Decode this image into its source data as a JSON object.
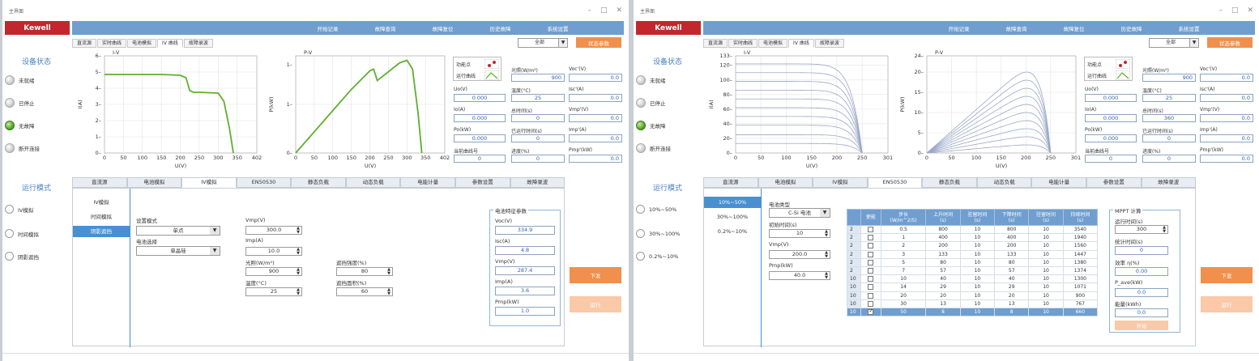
{
  "title": "主界面",
  "brand": "Kewell",
  "topnav": [
    "开始记录",
    "故障查询",
    "故障复位",
    "历史故障",
    "系统设置"
  ],
  "side": {
    "status_title": "设备状态",
    "statuses": [
      "未就绪",
      "已停止",
      "无故障",
      "断开连接"
    ],
    "mode_title": "运行模式"
  },
  "tabs_top": [
    "直流源",
    "实时曲线",
    "电池模拟",
    "IV 曲线",
    "故障录波"
  ],
  "select_all": "全部",
  "status_btn": "状态参数",
  "labels": {
    "func": "功能点",
    "run_curve": "运行曲线",
    "uo": "Uo(V)",
    "io": "Io(A)",
    "po": "Po(kW)",
    "curve_no": "当前曲线号",
    "irr": "光照(W/m²)",
    "temp": "温度(°C)",
    "tot": "总时间(s)",
    "elapsed": "已运行时间(s)",
    "progress": "进度(%)",
    "voc": "Voc'(V)",
    "isc": "Isc'(A)",
    "vmp": "Vmp'(V)",
    "imp": "Imp'(A)",
    "pmp": "Pmp'(kW)"
  },
  "w1": {
    "vals": {
      "irr": "900",
      "temp": "25",
      "tot": "0",
      "elapsed": "0",
      "progress": "0",
      "uo": "0.000",
      "io": "0.000",
      "po": "0.000",
      "curve_no": "0",
      "voc": "0.0",
      "isc": "0.0",
      "vmp": "0.0",
      "imp": "0.0",
      "pmp": "0.0"
    },
    "modes": [
      "IV模拟",
      "时间模拟",
      "阴影遮挡"
    ],
    "subtabs": [
      "IV模拟",
      "时间模拟",
      "阴影遮挡"
    ],
    "form": {
      "setmode_label": "设置模式",
      "setmode_value": "单点",
      "battery_label": "电池选择",
      "battery_value": "单晶硅",
      "vmp_label": "Vmp(V)",
      "vmp_value": "300.0",
      "imp_label": "Imp(A)",
      "imp_value": "10.0",
      "irr_label": "光照(W/m²)",
      "irr_value": "900",
      "temp_label": "温度(°C)",
      "temp_value": "25",
      "shade_label": "遮挡强度(%)",
      "shade_value": "80",
      "area_label": "遮挡面积(%)",
      "area_value": "60"
    },
    "char_title": "电池特征参数",
    "char": [
      {
        "label": "Voc(V)",
        "value": "334.9"
      },
      {
        "label": "Isc(A)",
        "value": "4.8"
      },
      {
        "label": "Vmp(V)",
        "value": "287.4"
      },
      {
        "label": "Imp(A)",
        "value": "3.6"
      },
      {
        "label": "Pmp(kW)",
        "value": "1.0"
      }
    ]
  },
  "w2": {
    "vals": {
      "irr": "900",
      "temp": "25",
      "tot": "360",
      "elapsed": "0",
      "progress": "0",
      "uo": "0.000",
      "io": "0.000",
      "po": "0.000",
      "curve_no": "0",
      "voc": "0.0",
      "isc": "0.0",
      "vmp": "0.0",
      "imp": "0.0",
      "pmp": "0.0"
    },
    "modes": [
      "10%~50%",
      "30%~100%",
      "0.2%~10%"
    ],
    "subtabs": [
      "10%~50%",
      "30%~100%",
      "0.2%~10%"
    ],
    "form": {
      "type_label": "电池类型",
      "type_value": "C-Si 电池",
      "init_label": "初始时间(s)",
      "init_value": "10",
      "vmp_label": "Vmp(V)",
      "vmp_value": "200.0",
      "pmp_label": "Pmp(kW)",
      "pmp_value": "40.0"
    },
    "table": {
      "headers": [
        "",
        "使能",
        "步长\n(W/m^2/S)",
        "上升时间\n(s)",
        "驻留时间\n(s)",
        "下降时间\n(s)",
        "驻留时间\n(s)",
        "持续时间\n(s)"
      ],
      "rows": [
        [
          "2",
          "0.5",
          "800",
          "10",
          "800",
          "10",
          "3540"
        ],
        [
          "2",
          "1",
          "400",
          "10",
          "400",
          "10",
          "1940"
        ],
        [
          "2",
          "2",
          "200",
          "10",
          "200",
          "10",
          "1560"
        ],
        [
          "2",
          "3",
          "133",
          "10",
          "133",
          "10",
          "1447"
        ],
        [
          "2",
          "5",
          "80",
          "10",
          "80",
          "10",
          "1380"
        ],
        [
          "2",
          "7",
          "57",
          "10",
          "57",
          "10",
          "1374"
        ],
        [
          "10",
          "10",
          "40",
          "10",
          "40",
          "10",
          "1300"
        ],
        [
          "10",
          "14",
          "29",
          "10",
          "29",
          "10",
          "1071"
        ],
        [
          "10",
          "20",
          "20",
          "10",
          "20",
          "10",
          "900"
        ],
        [
          "10",
          "30",
          "13",
          "10",
          "13",
          "10",
          "767"
        ],
        [
          "10",
          "50",
          "8",
          "10",
          "8",
          "10",
          "660"
        ]
      ]
    },
    "mppt": {
      "title": "MPPT 计算",
      "runtime_label": "运行时间(s)",
      "runtime_value": "300",
      "stat_label": "统计时间(s)",
      "stat_value": "0",
      "eff_label": "效率 η(%)",
      "eff_value": "0.00",
      "pave_label": "P_ave(kW)",
      "pave_value": "0.0",
      "energy_label": "能量(kWh)",
      "energy_value": "0.0",
      "start": "开始"
    }
  },
  "tabs_bottom": [
    "直流源",
    "电池模拟",
    "IV模拟",
    "EN50530",
    "静态负载",
    "动态负载",
    "电能计量",
    "参数设置",
    "故障录波"
  ],
  "btn_send": "下发",
  "btn_run": "运行",
  "chart_data": [
    {
      "type": "line",
      "title": "",
      "ylabel": "I(A)",
      "xlabel": "U(V)",
      "xlim": [
        0,
        402
      ],
      "ylim": [
        0,
        6
      ],
      "xticks": [
        "0",
        "50",
        "100",
        "150",
        "200",
        "250",
        "300",
        "350",
        "402"
      ],
      "yticks": [
        "0",
        "1",
        "2",
        "3",
        "4",
        "5",
        "6"
      ],
      "corner": "I-V",
      "series": [
        {
          "x": [
            0,
            150,
            200,
            215,
            225,
            235,
            250,
            300,
            315,
            330,
            340
          ],
          "y": [
            4.85,
            4.85,
            4.8,
            4.65,
            3.85,
            3.75,
            3.75,
            3.7,
            3.2,
            1.5,
            0
          ]
        }
      ]
    },
    {
      "type": "line",
      "title": "",
      "ylabel": "P(kW)",
      "xlabel": "U(V)",
      "xlim": [
        0,
        402
      ],
      "ylim": [
        0,
        1.1
      ],
      "xticks": [
        "0",
        "50",
        "100",
        "150",
        "200",
        "250",
        "300",
        "350",
        "402"
      ],
      "yticks": [
        "0",
        "1"
      ],
      "yticklevels": [
        0,
        0.55,
        1.0
      ],
      "corner": "P-V",
      "series": [
        {
          "x": [
            0,
            50,
            100,
            150,
            200,
            210,
            220,
            235,
            250,
            280,
            300,
            315,
            330,
            340
          ],
          "y": [
            0,
            0.24,
            0.48,
            0.72,
            0.93,
            0.95,
            0.82,
            0.87,
            0.92,
            1.02,
            1.05,
            0.95,
            0.45,
            0
          ]
        }
      ]
    },
    {
      "type": "line",
      "title": "",
      "ylabel": "I(A)",
      "xlabel": "U(V)",
      "xlim": [
        0,
        301
      ],
      "ylim": [
        0,
        133
      ],
      "xticks": [
        "0",
        "50",
        "100",
        "150",
        "200",
        "250",
        "301"
      ],
      "yticks": [
        "0",
        "20",
        "40",
        "60",
        "80",
        "100",
        "120",
        "133"
      ],
      "corner": "I-V",
      "series": [
        {
          "isc": [
            13,
            25,
            38,
            50,
            62,
            74,
            86,
            98,
            110,
            122
          ]
        }
      ]
    },
    {
      "type": "line",
      "title": "",
      "ylabel": "P(kW)",
      "xlabel": "U(V)",
      "xlim": [
        0,
        301
      ],
      "ylim": [
        0,
        24
      ],
      "xticks": [
        "0",
        "50",
        "100",
        "150",
        "200",
        "250",
        "301"
      ],
      "yticks": [
        "0",
        "5",
        "10",
        "15",
        "20",
        "24"
      ],
      "corner": "P-V",
      "series": [
        {
          "pmax": [
            2,
            4,
            6,
            8,
            10,
            12,
            14,
            16,
            18,
            20
          ]
        }
      ]
    }
  ]
}
